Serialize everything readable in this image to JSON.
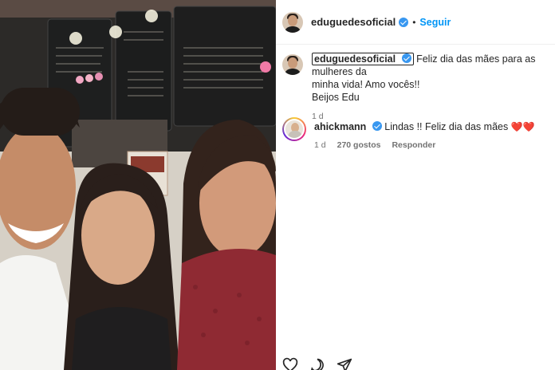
{
  "post": {
    "author": {
      "username": "eduguedesoficial",
      "follow_label": "Seguir",
      "separator": "•"
    },
    "caption": {
      "username": "eduguedesoficial",
      "text_line1": "Feliz dia das mães para as mulheres da",
      "text_line2": "minha vida! Amo vocês!!",
      "text_line3": "Beijos Edu",
      "time": "1 d"
    },
    "comments": [
      {
        "username": "ahickmann",
        "text": "Lindas !! Feliz dia das mães",
        "emoji": "❤️❤️",
        "time": "1 d",
        "likes": "270 gostos",
        "reply_label": "Responder"
      }
    ],
    "icons": {
      "verified": "verified-badge-icon",
      "like": "heart-outline-icon",
      "comment": "comment-bubble-icon",
      "share": "paper-plane-icon"
    },
    "colors": {
      "follow": "#0095f6",
      "verified": "#3897f0",
      "heart": "#ed4956"
    }
  }
}
